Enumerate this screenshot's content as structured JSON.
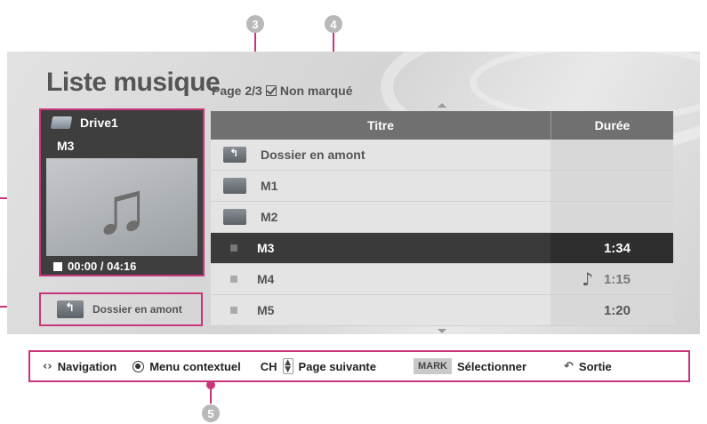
{
  "callouts": {
    "c3": "3",
    "c4": "4",
    "c5": "5"
  },
  "header": {
    "title": "Liste musique",
    "page": "Page 2/3",
    "mark_status": "Non marqué"
  },
  "now_playing": {
    "drive": "Drive1",
    "track": "M3",
    "time": "00:00 / 04:16"
  },
  "up_folder_button": "Dossier en amont",
  "list": {
    "col_title": "Titre",
    "col_duration": "Durée",
    "rows": [
      {
        "type": "parent-folder",
        "title": "Dossier en amont",
        "duration": ""
      },
      {
        "type": "folder",
        "title": "M1",
        "duration": ""
      },
      {
        "type": "folder",
        "title": "M2",
        "duration": ""
      },
      {
        "type": "file",
        "title": "M3",
        "duration": "1:34",
        "selected": true
      },
      {
        "type": "file",
        "title": "M4",
        "duration": "1:15",
        "playing": true
      },
      {
        "type": "file",
        "title": "M5",
        "duration": "1:20"
      }
    ]
  },
  "bottom_bar": {
    "navigation": "Navigation",
    "context_menu": "Menu contextuel",
    "ch_label": "CH",
    "next_page": "Page suivante",
    "mark_key": "MARK",
    "select": "Sélectionner",
    "exit": "Sortie"
  },
  "colors": {
    "callout_accent": "#c8357a",
    "callout_number": "#b9b9b9"
  }
}
